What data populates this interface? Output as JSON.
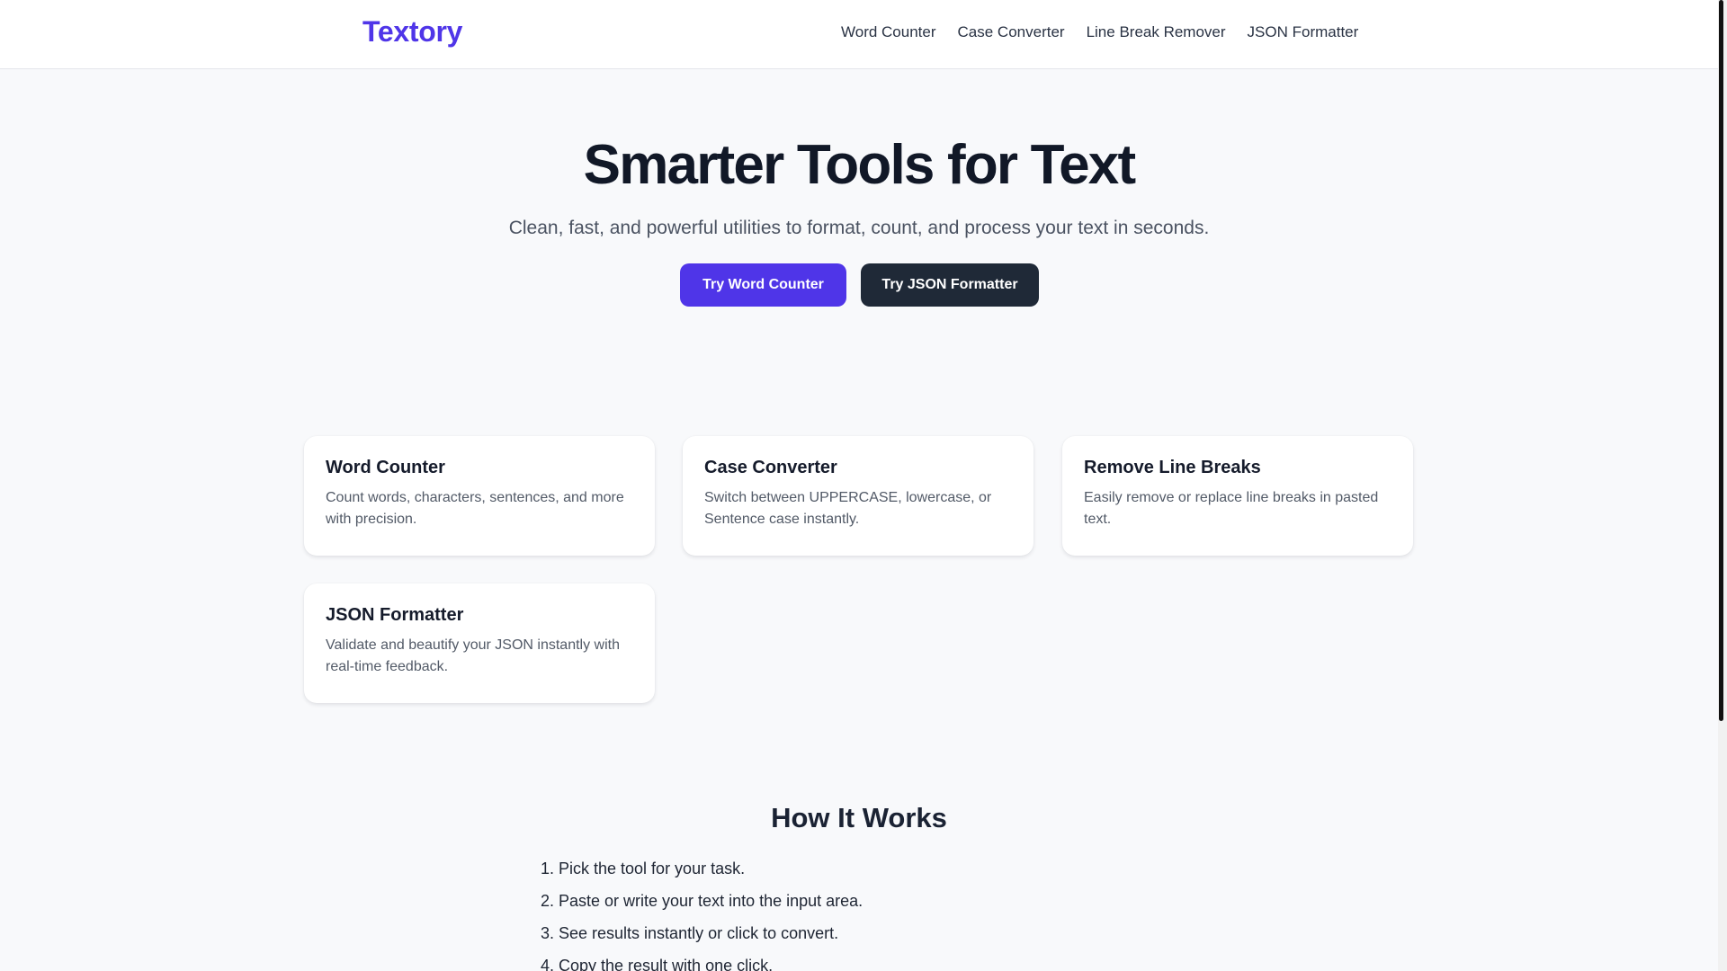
{
  "header": {
    "brand": "Textory",
    "nav": [
      "Word Counter",
      "Case Converter",
      "Line Break Remover",
      "JSON Formatter"
    ]
  },
  "hero": {
    "title": "Smarter Tools for Text",
    "subtitle": "Clean, fast, and powerful utilities to format, count, and process your text in seconds.",
    "primary_button": "Try Word Counter",
    "secondary_button": "Try JSON Formatter"
  },
  "cards": [
    {
      "title": "Word Counter",
      "desc": "Count words, characters, sentences, and more with precision."
    },
    {
      "title": "Case Converter",
      "desc": "Switch between UPPERCASE, lowercase, or Sentence case instantly."
    },
    {
      "title": "Remove Line Breaks",
      "desc": "Easily remove or replace line breaks in pasted text."
    },
    {
      "title": "JSON Formatter",
      "desc": "Validate and beautify your JSON instantly with real-time feedback."
    }
  ],
  "how_it_works": {
    "title": "How It Works",
    "steps": [
      {
        "num": "1.",
        "text": "Pick the tool for your task."
      },
      {
        "num": "2.",
        "text": "Paste or write your text into the input area."
      },
      {
        "num": "3.",
        "text": "See results instantly or click to convert."
      },
      {
        "num": "4.",
        "text": "Copy the result with one click."
      }
    ]
  },
  "colors": {
    "brand": "#4f35e8",
    "dark_button": "#1f2937",
    "background": "#f8f9fb"
  }
}
